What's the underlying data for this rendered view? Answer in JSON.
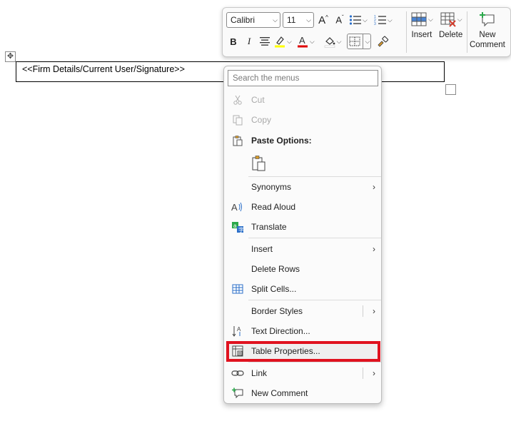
{
  "document": {
    "cell_text": "<<Firm Details/Current User/Signature>>"
  },
  "toolbar": {
    "font_name": "Calibri",
    "font_size": "11",
    "grow_font_label": "A^",
    "shrink_font_label": "A˅",
    "bold_label": "B",
    "italic_label": "I",
    "insert_label": "Insert",
    "delete_label": "Delete",
    "new_comment_label_line1": "New",
    "new_comment_label_line2": "Comment",
    "colors": {
      "highlight": "#ffff00",
      "font_color": "#e00000",
      "accent_blue": "#2b6fc9",
      "delete_red": "#d23b2b",
      "comment_green": "#2aa84a"
    }
  },
  "menu": {
    "search_placeholder": "Search the menus",
    "cut": "Cut",
    "copy": "Copy",
    "paste_options": "Paste Options:",
    "synonyms": "Synonyms",
    "read_aloud": "Read Aloud",
    "translate": "Translate",
    "insert": "Insert",
    "delete_rows": "Delete Rows",
    "split_cells": "Split Cells...",
    "border_styles": "Border Styles",
    "text_direction": "Text Direction...",
    "table_properties": "Table Properties...",
    "link": "Link",
    "new_comment": "New Comment",
    "highlight_color": "#e0121f"
  }
}
